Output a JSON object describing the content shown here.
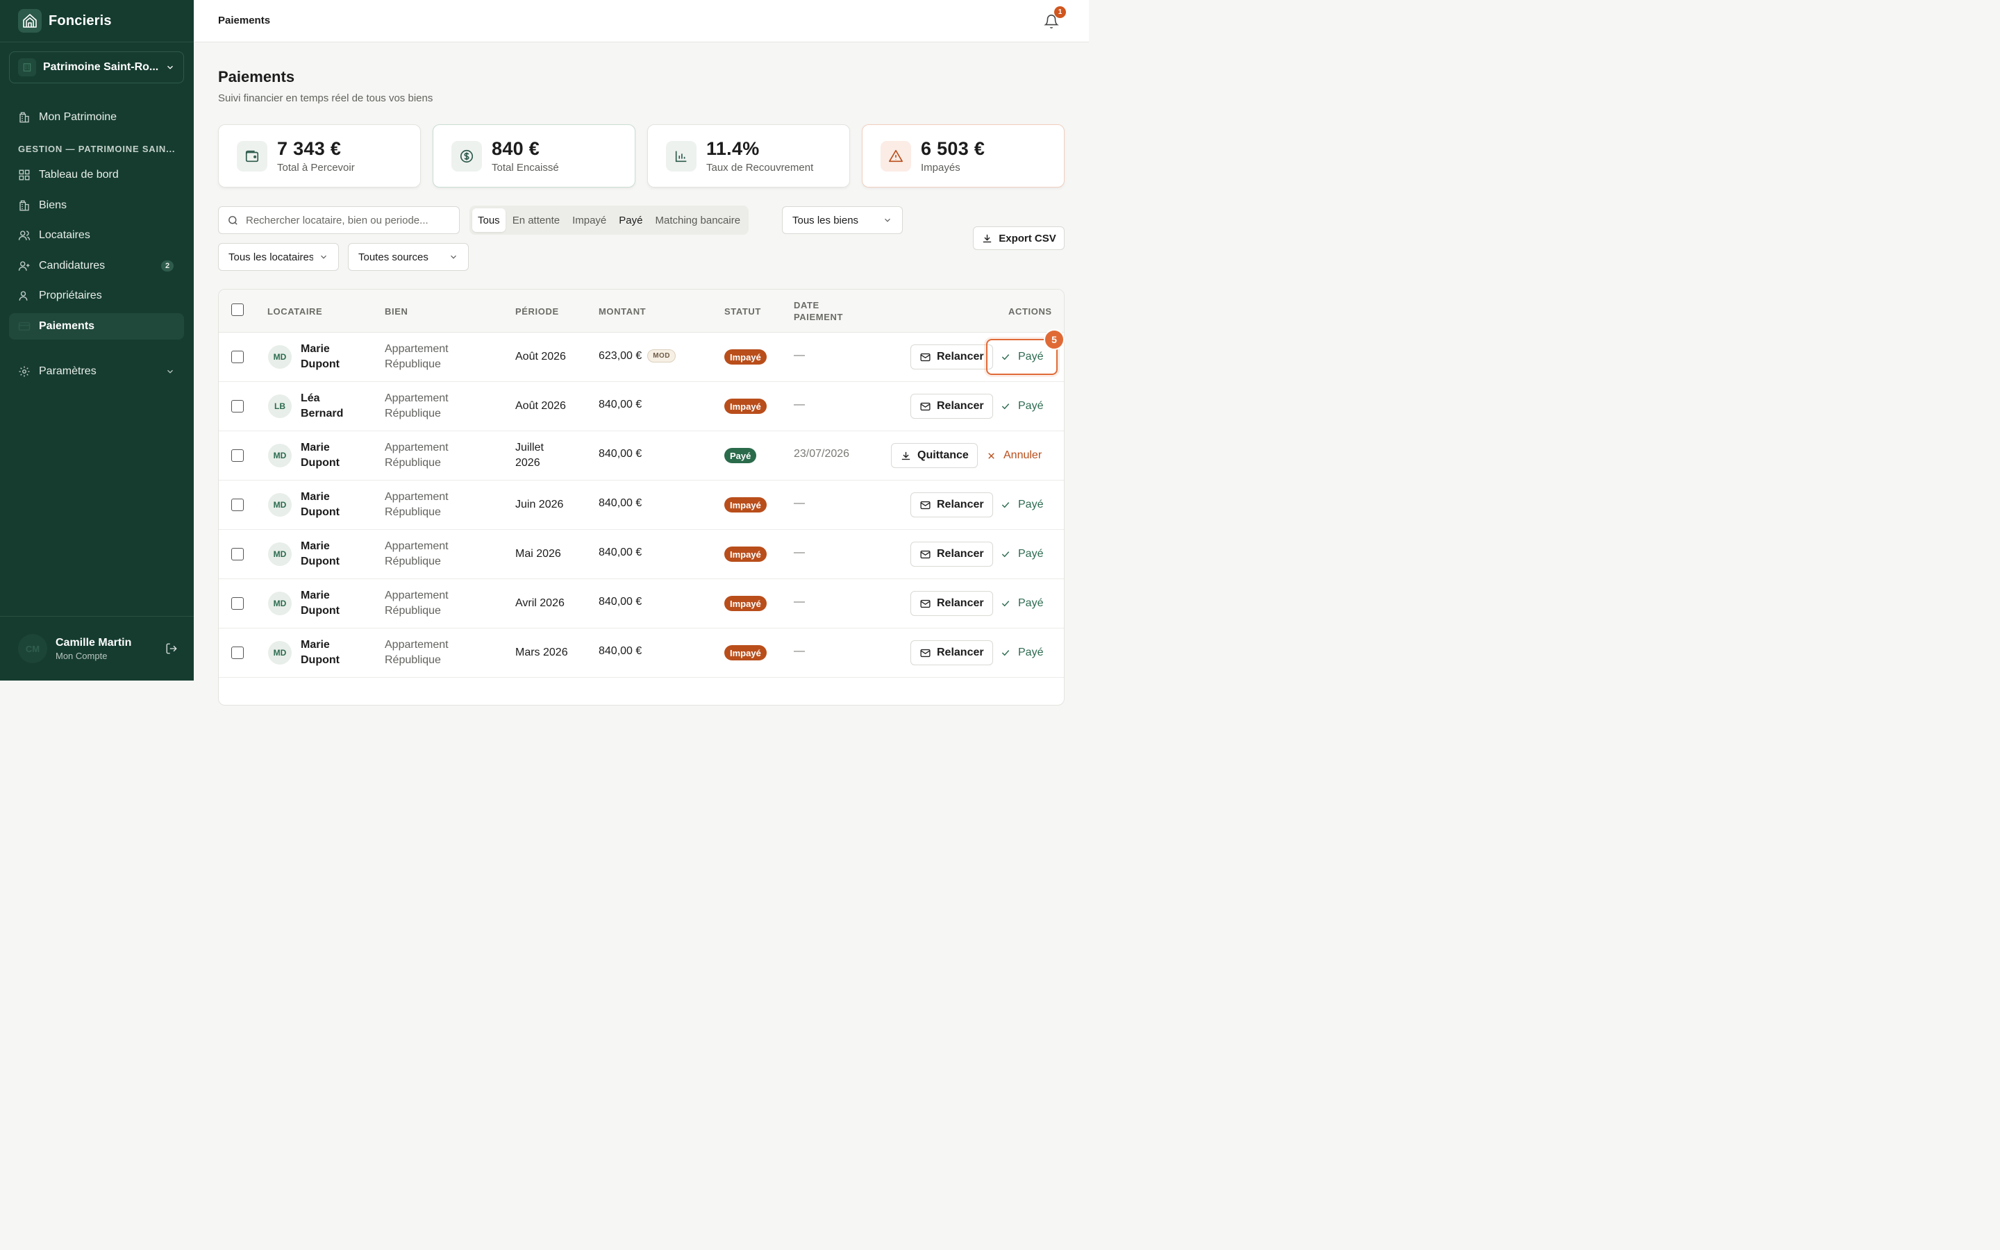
{
  "app": {
    "name": "Foncieris"
  },
  "sidebar": {
    "org": "Patrimoine Saint-Ro...",
    "top_item": "Mon Patrimoine",
    "section_label": "GESTION — PATRIMOINE SAIN...",
    "items": [
      {
        "label": "Tableau de bord",
        "icon": "dashboard-icon"
      },
      {
        "label": "Biens",
        "icon": "building-icon"
      },
      {
        "label": "Locataires",
        "icon": "users-icon"
      },
      {
        "label": "Candidatures",
        "icon": "user-plus-icon",
        "badge": "2"
      },
      {
        "label": "Propriétaires",
        "icon": "user-icon"
      },
      {
        "label": "Paiements",
        "icon": "credit-card-icon",
        "active": true
      }
    ],
    "settings": "Paramètres",
    "account": {
      "initials": "CM",
      "name": "Camille Martin",
      "sub": "Mon Compte"
    }
  },
  "header": {
    "title": "Paiements",
    "notifications": "1"
  },
  "main": {
    "title": "Paiements",
    "subtitle": "Suivi financier en temps réel de tous vos biens"
  },
  "kpis": [
    {
      "value": "7 343 €",
      "label": "Total à Percevoir",
      "icon": "wallet-icon"
    },
    {
      "value": "840 €",
      "label": "Total Encaissé",
      "icon": "dollar-circle-icon"
    },
    {
      "value": "11.4%",
      "label": "Taux de Recouvrement",
      "icon": "bar-chart-icon"
    },
    {
      "value": "6 503 €",
      "label": "Impayés",
      "icon": "warning-icon"
    }
  ],
  "filters": {
    "search_placeholder": "Rechercher locataire, bien ou periode...",
    "tabs": [
      "Tous",
      "En attente",
      "Impayé",
      "Payé",
      "Matching bancaire"
    ],
    "property_select": "Tous les biens",
    "tenant_select": "Tous les locataires",
    "source_select": "Toutes sources",
    "export": "Export CSV"
  },
  "table": {
    "columns": [
      "LOCATAIRE",
      "BIEN",
      "PÉRIODE",
      "MONTANT",
      "STATUT",
      "DATE PAIEMENT",
      "ACTIONS"
    ],
    "rows": [
      {
        "initials": "MD",
        "tenant": "Marie Dupont",
        "property": "Appartement République",
        "period": "Août 2026",
        "amount": "623,00 €",
        "tag": "MOD",
        "status": "Impayé",
        "date": "—",
        "action1": "Relancer",
        "action2": "Payé"
      },
      {
        "initials": "LB",
        "tenant": "Léa Bernard",
        "property": "Appartement République",
        "period": "Août 2026",
        "amount": "840,00 €",
        "tag": "",
        "status": "Impayé",
        "date": "—",
        "action1": "Relancer",
        "action2": "Payé"
      },
      {
        "initials": "MD",
        "tenant": "Marie Dupont",
        "property": "Appartement République",
        "period": "Juillet 2026",
        "amount": "840,00 €",
        "tag": "",
        "status": "Payé",
        "date": "23/07/2026",
        "action1": "Quittance",
        "action2": "Annuler"
      },
      {
        "initials": "MD",
        "tenant": "Marie Dupont",
        "property": "Appartement République",
        "period": "Juin 2026",
        "amount": "840,00 €",
        "tag": "",
        "status": "Impayé",
        "date": "—",
        "action1": "Relancer",
        "action2": "Payé"
      },
      {
        "initials": "MD",
        "tenant": "Marie Dupont",
        "property": "Appartement République",
        "period": "Mai 2026",
        "amount": "840,00 €",
        "tag": "",
        "status": "Impayé",
        "date": "—",
        "action1": "Relancer",
        "action2": "Payé"
      },
      {
        "initials": "MD",
        "tenant": "Marie Dupont",
        "property": "Appartement République",
        "period": "Avril 2026",
        "amount": "840,00 €",
        "tag": "",
        "status": "Impayé",
        "date": "—",
        "action1": "Relancer",
        "action2": "Payé"
      },
      {
        "initials": "MD",
        "tenant": "Marie Dupont",
        "property": "Appartement République",
        "period": "Mars 2026",
        "amount": "840,00 €",
        "tag": "",
        "status": "Impayé",
        "date": "—",
        "action1": "Relancer",
        "action2": "Payé"
      }
    ]
  },
  "highlight": {
    "badge": "5"
  },
  "colors": {
    "sidebar": "#163c30",
    "accent": "#2c6b50",
    "unpaid": "#b94e1b",
    "highlight": "#e06a36"
  }
}
